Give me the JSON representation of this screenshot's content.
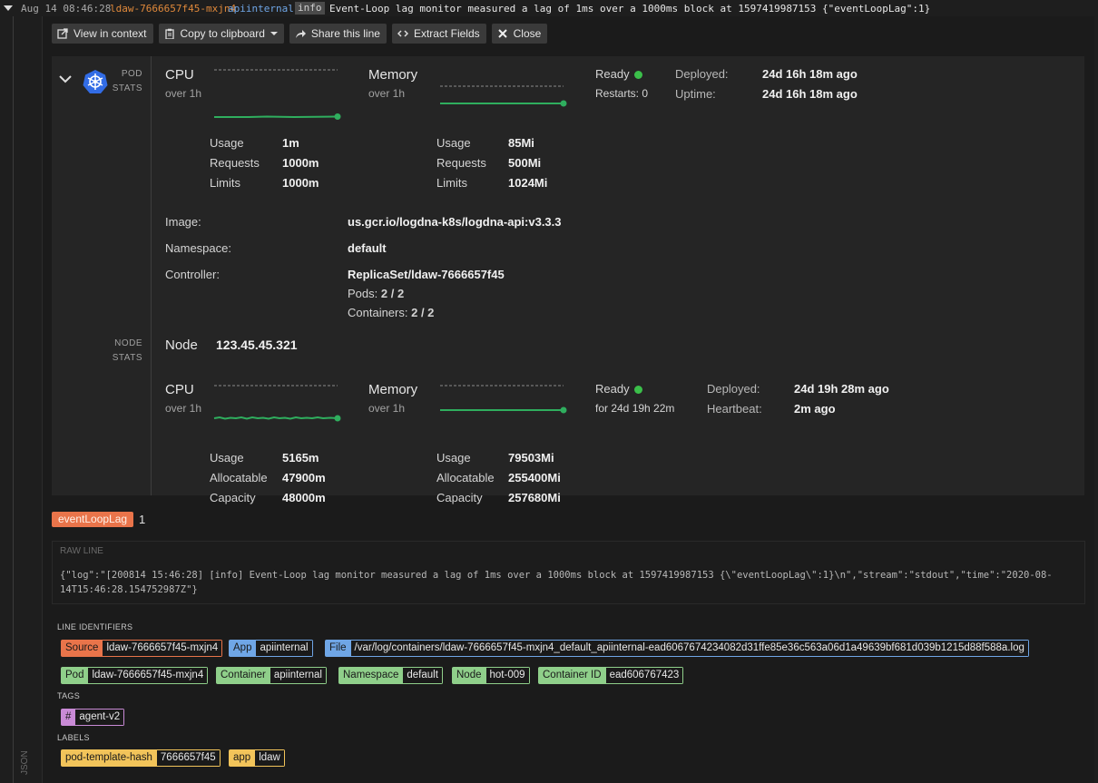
{
  "log_line": {
    "timestamp": "Aug 14 08:46:28",
    "source": "ldaw-7666657f45-mxjn4",
    "app": "apiinternal",
    "level": "info",
    "message": "Event-Loop lag monitor measured a lag of 1ms over a 1000ms block at 1597419987153 {\"eventLoopLag\":1}"
  },
  "toolbar": {
    "view_context": "View in context",
    "copy": "Copy to clipboard",
    "share": "Share this line",
    "extract": "Extract Fields",
    "close": "Close"
  },
  "pod": {
    "section_label_1": "POD",
    "section_label_2": "STATS",
    "cpu": {
      "title": "CPU",
      "sub": "over 1h",
      "usage_label": "Usage",
      "usage": "1m",
      "requests_label": "Requests",
      "requests": "1000m",
      "limits_label": "Limits",
      "limits": "1000m"
    },
    "memory": {
      "title": "Memory",
      "sub": "over 1h",
      "usage_label": "Usage",
      "usage": "85Mi",
      "requests_label": "Requests",
      "requests": "500Mi",
      "limits_label": "Limits",
      "limits": "1024Mi"
    },
    "status": {
      "ready": "Ready",
      "restarts": "Restarts: 0",
      "deployed_label": "Deployed:",
      "deployed": "24d 16h 18m ago",
      "uptime_label": "Uptime:",
      "uptime": "24d 16h 18m ago"
    },
    "image_label": "Image:",
    "image": "us.gcr.io/logdna-k8s/logdna-api:v3.3.3",
    "namespace_label": "Namespace:",
    "namespace": "default",
    "controller_label": "Controller:",
    "controller": "ReplicaSet/ldaw-7666657f45",
    "pods_label": "Pods:",
    "pods": "2 / 2",
    "containers_label": "Containers:",
    "containers": "2 / 2"
  },
  "node": {
    "section_label_1": "NODE",
    "section_label_2": "STATS",
    "title": "Node",
    "ip": "123.45.45.321",
    "cpu": {
      "title": "CPU",
      "sub": "over 1h",
      "usage_label": "Usage",
      "usage": "5165m",
      "alloc_label": "Allocatable",
      "alloc": "47900m",
      "cap_label": "Capacity",
      "cap": "48000m"
    },
    "memory": {
      "title": "Memory",
      "sub": "over 1h",
      "usage_label": "Usage",
      "usage": "79503Mi",
      "alloc_label": "Allocatable",
      "alloc": "255400Mi",
      "cap_label": "Capacity",
      "cap": "257680Mi"
    },
    "status": {
      "ready": "Ready",
      "for": "for 24d 19h 22m",
      "deployed_label": "Deployed:",
      "deployed": "24d 19h 28m ago",
      "heartbeat_label": "Heartbeat:",
      "heartbeat": "2m ago"
    }
  },
  "extracted": {
    "field": "eventLoopLag",
    "value": "1"
  },
  "raw_line": {
    "header": "RAW LINE",
    "line1": "{\"log\":\"[200814 15:46:28] [info] Event-Loop lag monitor measured a lag of 1ms over a 1000ms block at 1597419987153 {\\\"eventLoopLag\\\":1}\\n\",\"stream\":\"stdout\",\"time\":\"2020-08-",
    "line2": "14T15:46:28.154752987Z\"}"
  },
  "identifiers": {
    "header": "LINE IDENTIFIERS",
    "source_k": "Source",
    "source_v": "ldaw-7666657f45-mxjn4",
    "app_k": "App",
    "app_v": "apiinternal",
    "file_k": "File",
    "file_v": "/var/log/containers/ldaw-7666657f45-mxjn4_default_apiinternal-ead6067674234082d31ffe85e36c563a06d1a49639bf681d039b1215d88f588a.log",
    "pod_k": "Pod",
    "pod_v": "ldaw-7666657f45-mxjn4",
    "container_k": "Container",
    "container_v": "apiinternal",
    "namespace_k": "Namespace",
    "namespace_v": "default",
    "node_k": "Node",
    "node_v": "hot-009",
    "cid_k": "Container ID",
    "cid_v": "ead606767423"
  },
  "tags": {
    "header": "TAGS",
    "hash": "#",
    "value": "agent-v2"
  },
  "labels": {
    "header": "LABELS",
    "l1_k": "pod-template-hash",
    "l1_v": "7666657f45",
    "l2_k": "app",
    "l2_v": "ldaw"
  },
  "json_toggle": "JSON",
  "colors": {
    "accent_green": "#3bbf4a",
    "source_orange": "#e9744a",
    "app_blue": "#6fa6e6",
    "id_green": "#8fcf8a",
    "tag_purple": "#c98ad6",
    "label_yellow": "#f2c45a"
  }
}
